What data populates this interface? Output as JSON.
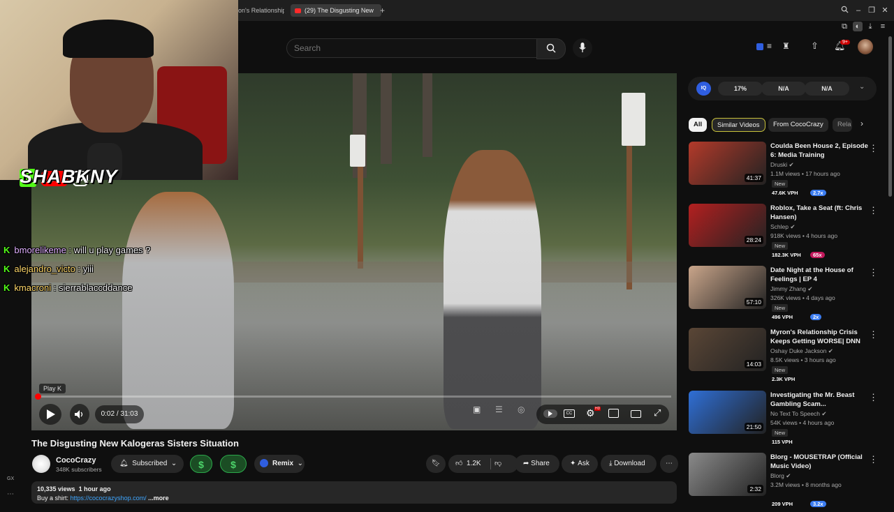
{
  "browser": {
    "tabs": [
      {
        "label": "on's Relationship",
        "active": false
      },
      {
        "label": "(29) The Disgusting New",
        "active": true
      }
    ],
    "new_tab": "+"
  },
  "header": {
    "search_placeholder": "Search",
    "notification_count": "9+"
  },
  "overlay": {
    "handle": "SHABKNY",
    "chat": [
      {
        "user": "bmorelikeme",
        "message": "will u play games ?"
      },
      {
        "user": "alejandro_victo",
        "message": "yiii"
      },
      {
        "user": "kmacroni",
        "message": "sierrablaccddance"
      }
    ]
  },
  "player": {
    "tooltip": "Play  K",
    "time": "0:02 / 31:03",
    "progress_fraction": 0.001,
    "hd_badge": "HD"
  },
  "video": {
    "title": "The Disgusting New Kalogeras Sisters Situation",
    "channel": "CocoCrazy",
    "subscribers": "348K subscribers",
    "subscribe_label": "Subscribed",
    "remix_label": "Remix",
    "likes": "1.2K",
    "share_label": "Share",
    "ask_label": "Ask",
    "download_label": "Download",
    "views": "10,335 views",
    "age": "1 hour ago",
    "description_prefix": "Buy a shirt: ",
    "description_link": "https://cococrazyshop.com/",
    "more": "...more"
  },
  "extension": {
    "pills": [
      "17%",
      "N/A",
      "N/A"
    ],
    "logo": "IQ"
  },
  "filters": [
    "All",
    "Similar Videos",
    "From CocoCrazy",
    "Rela"
  ],
  "recommendations": [
    {
      "title": "Coulda Been House 2, Episode 6: Media Training",
      "channel": "Druski",
      "meta": "1.1M views • 17 hours ago",
      "badge": "New",
      "vph": "47.6K VPH",
      "mult": "2.7x",
      "mult_color": "#3b7cf0",
      "duration": "41:37",
      "thumb_color": "#b33a2a"
    },
    {
      "title": "Roblox, Take a Seat (ft: Chris Hansen)",
      "channel": "Schlep",
      "meta": "918K views • 4 hours ago",
      "badge": "New",
      "vph": "182.3K VPH",
      "mult": "65x",
      "mult_color": "#c2185b",
      "duration": "28:24",
      "thumb_color": "#b32020"
    },
    {
      "title": "Date Night at the House of Feelings | EP 4",
      "channel": "Jimmy Zhang",
      "meta": "326K views • 4 days ago",
      "badge": "New",
      "vph": "496 VPH",
      "mult": "2x",
      "mult_color": "#3b7cf0",
      "duration": "57:10",
      "thumb_color": "#c9a58a"
    },
    {
      "title": "Myron's Relationship Crisis Keeps Getting WORSE| DNN",
      "channel": "Oshay Duke Jackson",
      "meta": "8.5K views • 3 hours ago",
      "badge": "New",
      "vph": "2.3K VPH",
      "mult": "",
      "mult_color": "",
      "duration": "14:03",
      "thumb_color": "#5a4636"
    },
    {
      "title": "Investigating the Mr. Beast Gambling Scam...",
      "channel": "No Text To Speech",
      "meta": "54K views • 4 hours ago",
      "badge": "New",
      "vph": "115 VPH",
      "mult": "",
      "mult_color": "",
      "duration": "21:50",
      "thumb_color": "#2f6fd6"
    },
    {
      "title": "Blorg - MOUSETRAP (Official Music Video)",
      "channel": "Blorg",
      "meta": "3.2M views • 8 months ago",
      "badge": "",
      "vph": "209 VPH",
      "mult": "3.2x",
      "mult_color": "#3b7cf0",
      "duration": "2:32",
      "thumb_color": "#8a8a8a"
    }
  ],
  "sidebar_left": {
    "label": "GX"
  },
  "colors": {
    "accent_red": "#ff0000",
    "kick_green": "#53fc18",
    "money_green": "#1e7a2e"
  }
}
